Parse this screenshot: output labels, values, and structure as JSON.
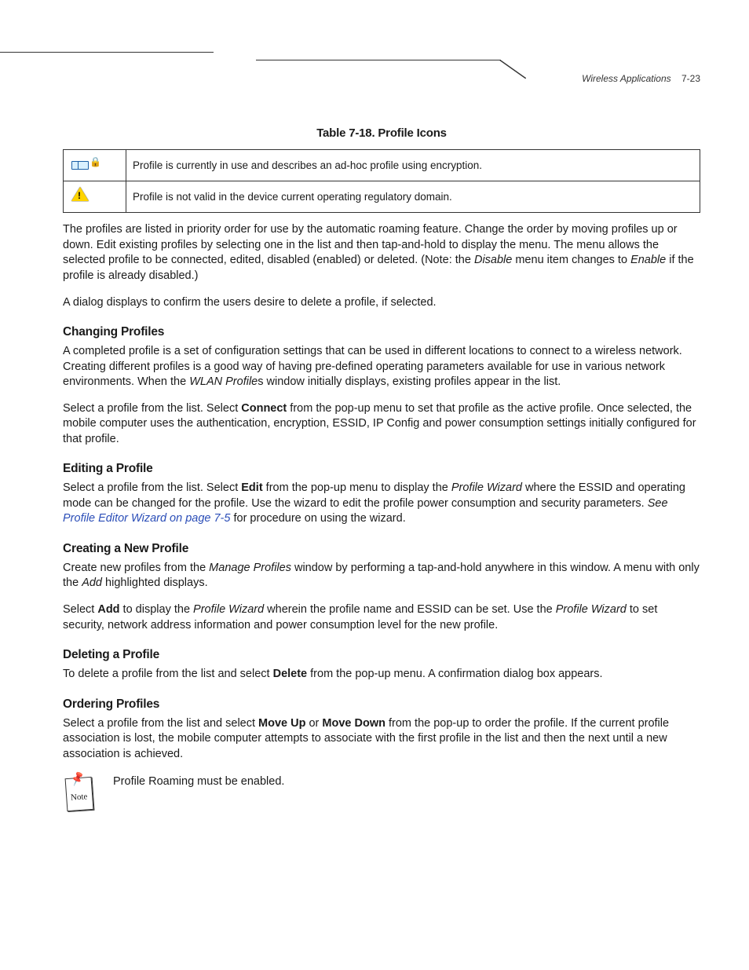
{
  "header": {
    "section": "Wireless Applications",
    "page_number": "7-23"
  },
  "table": {
    "title": "Table 7-18. Profile Icons",
    "rows": [
      {
        "icon": "adhoc-encrypted-icon",
        "desc": "Profile is currently in use and describes an ad-hoc profile using encryption."
      },
      {
        "icon": "warning-icon",
        "desc": "Profile is not valid in the device current operating regulatory domain."
      }
    ]
  },
  "intro": {
    "p1_a": "The profiles are listed in priority order for use by the automatic roaming feature. Change the order by moving profiles up or down. Edit existing profiles by selecting one in the list and then tap-and-hold to display the menu. The menu allows the selected profile to be connected, edited, disabled (enabled) or deleted. (Note: the ",
    "p1_i1": "Disable",
    "p1_b": " menu item changes to ",
    "p1_i2": "Enable",
    "p1_c": " if the profile is already disabled.)",
    "p2": "A dialog displays to confirm the users desire to delete a profile, if selected."
  },
  "changing": {
    "title": "Changing Profiles",
    "p1_a": "A completed profile is a set of configuration settings that can be used in different locations to connect to a wireless network. Creating different profiles is a good way of having pre-defined operating parameters available for use in various network environments. When the ",
    "p1_i1": "WLAN Profile",
    "p1_b": "s window initially displays, existing profiles appear in the list.",
    "p2_a": "Select a profile from the list. Select ",
    "p2_b1": "Connect",
    "p2_b": " from the pop-up menu to set that profile as the active profile. Once selected, the mobile computer uses the authentication, encryption, ESSID, IP Config and power consumption settings initially configured for that profile."
  },
  "editing": {
    "title": "Editing a Profile",
    "p1_a": "Select a profile from the list. Select ",
    "p1_b1": "Edit",
    "p1_b": " from the pop-up menu to display the ",
    "p1_i1": "Profile Wizard",
    "p1_c": " where the ESSID and operating mode can be changed for the profile. Use the wizard to edit the profile power consumption and security parameters. ",
    "p1_i2": "See ",
    "p1_xref": "Profile Editor Wizard on page 7-5",
    "p1_d": " for procedure on using the wizard."
  },
  "creating": {
    "title": "Creating a New Profile",
    "p1_a": "Create new profiles from the ",
    "p1_i1": "Manage Profiles",
    "p1_b": " window by performing a tap-and-hold anywhere in this window. A menu with only the ",
    "p1_i2": "Add",
    "p1_c": " highlighted displays.",
    "p2_a": "Select ",
    "p2_b1": "Add",
    "p2_b": " to display the ",
    "p2_i1": "Profile Wizard",
    "p2_c": " wherein the profile name and ESSID can be set. Use the ",
    "p2_i2": "Profile Wizard",
    "p2_d": " to set security, network address information and power consumption level for the new profile."
  },
  "deleting": {
    "title": "Deleting a Profile",
    "p1_a": "To delete a profile from the list and select ",
    "p1_b1": "Delete",
    "p1_b": " from the pop-up menu. A confirmation dialog box appears."
  },
  "ordering": {
    "title": "Ordering Profiles",
    "p1_a": "Select a profile from the list and select ",
    "p1_b1": "Move Up",
    "p1_b": " or ",
    "p1_b2": "Move Down",
    "p1_c": " from the pop-up to order the profile. If the current profile association is lost, the mobile computer attempts to associate with the first profile in the list and then the next until a new association is achieved."
  },
  "note": {
    "label": "Note",
    "text": "Profile Roaming must be enabled."
  }
}
